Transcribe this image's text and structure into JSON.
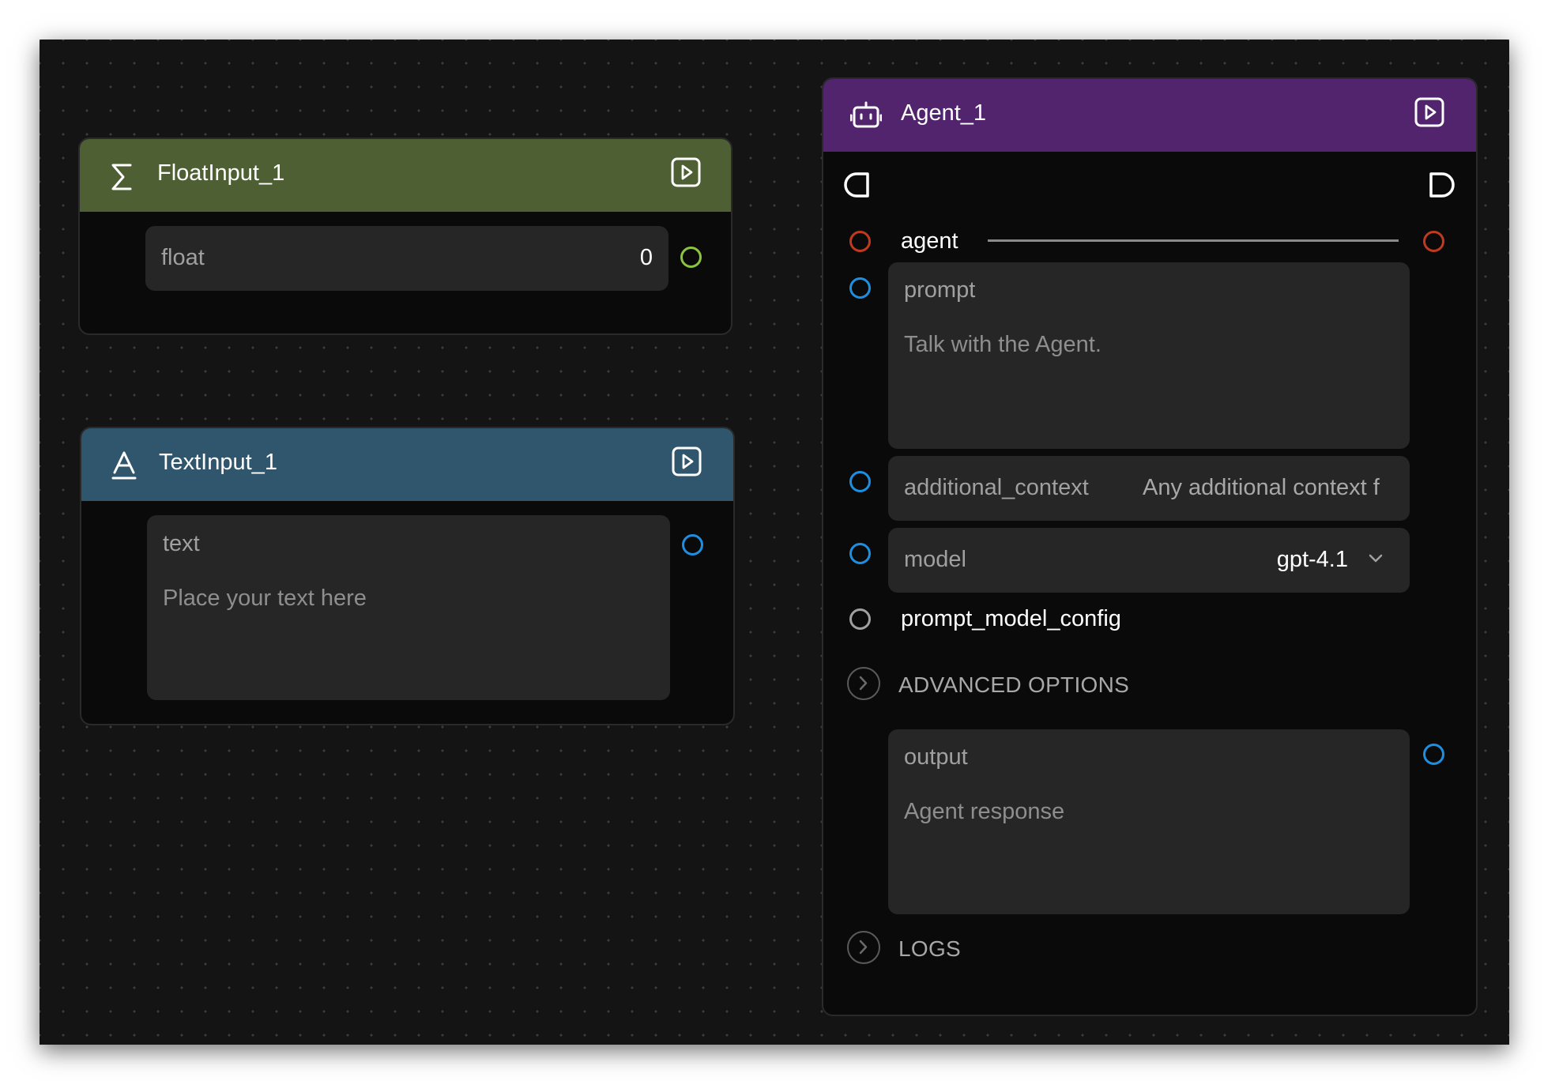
{
  "float_node": {
    "title": "FloatInput_1",
    "icon": "sigma-icon",
    "header_color": "#4e6033",
    "field_label": "float",
    "field_value": "0",
    "handle_color": "#8bc53f"
  },
  "text_node": {
    "title": "TextInput_1",
    "icon": "text-icon",
    "header_color": "#30566e",
    "field_label": "text",
    "placeholder": "Place your text here"
  },
  "agent_node": {
    "title": "Agent_1",
    "icon": "robot-icon",
    "header_color": "#52246e",
    "agent_label": "agent",
    "prompt_label": "prompt",
    "prompt_placeholder": "Talk with the Agent.",
    "additional_context_label": "additional_context",
    "additional_context_placeholder": "Any additional context f",
    "model_label": "model",
    "model_value": "gpt-4.1",
    "prompt_model_config_label": "prompt_model_config",
    "advanced_options_label": "ADVANCED OPTIONS",
    "output_label": "output",
    "output_placeholder": "Agent response",
    "logs_label": "LOGS"
  },
  "colors": {
    "handle_blue": "#1e8fe0",
    "handle_red": "#c03a1e",
    "handle_gray": "#a0a0a0"
  }
}
